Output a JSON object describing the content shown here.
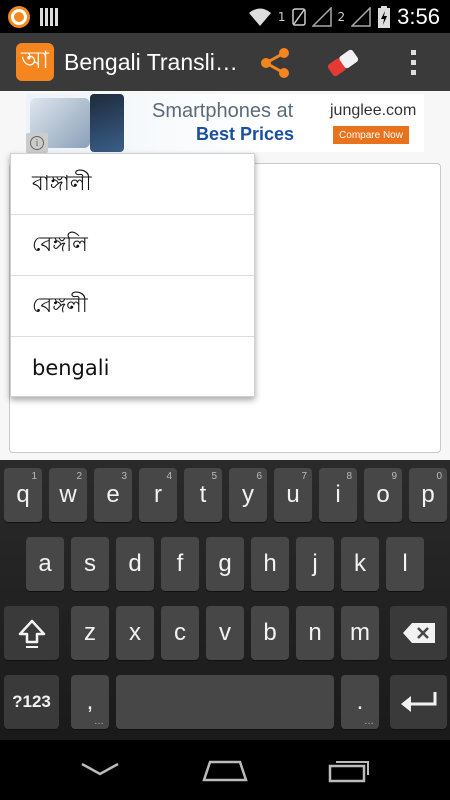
{
  "status_bar": {
    "time": "3:56",
    "sim1": "1",
    "sim2": "2"
  },
  "action_bar": {
    "app_icon_glyph": "আ",
    "title": "Bengali Transli…",
    "share_icon": "share-icon",
    "eraser_icon": "eraser-icon",
    "overflow_icon": "overflow-menu-icon",
    "accent_color": "#f5851f"
  },
  "ad": {
    "line1": "Smartphones at",
    "line2": "Best Prices",
    "brand": "junglee.com",
    "cta": "Compare Now"
  },
  "suggestions": [
    {
      "label": "বাঙ্গালী"
    },
    {
      "label": "বেঙ্গলি"
    },
    {
      "label": "বেঙ্গলী"
    },
    {
      "label": "bengali"
    }
  ],
  "keyboard": {
    "row1": [
      {
        "label": "q",
        "hint": "1"
      },
      {
        "label": "w",
        "hint": "2"
      },
      {
        "label": "e",
        "hint": "3"
      },
      {
        "label": "r",
        "hint": "4"
      },
      {
        "label": "t",
        "hint": "5"
      },
      {
        "label": "y",
        "hint": "6"
      },
      {
        "label": "u",
        "hint": "7"
      },
      {
        "label": "i",
        "hint": "8"
      },
      {
        "label": "o",
        "hint": "9"
      },
      {
        "label": "p",
        "hint": "0"
      }
    ],
    "row2": [
      "a",
      "s",
      "d",
      "f",
      "g",
      "h",
      "j",
      "k",
      "l"
    ],
    "row3": [
      "z",
      "x",
      "c",
      "v",
      "b",
      "n",
      "m"
    ],
    "symbols_label": "?123",
    "comma_label": ",",
    "period_label": ".",
    "space_label": ""
  }
}
